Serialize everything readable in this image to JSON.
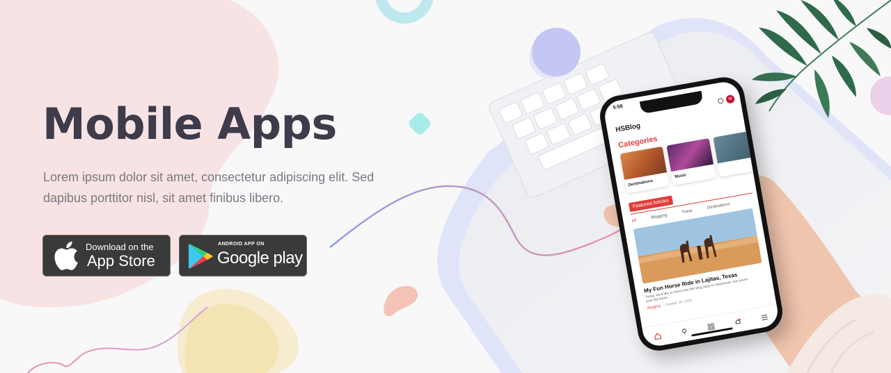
{
  "hero": {
    "title": "Mobile Apps",
    "description": "Lorem ipsum dolor sit amet, consectetur adipiscing elit. Sed dapibus porttitor nisl, sit amet finibus libero."
  },
  "store_buttons": {
    "apple": {
      "small": "Download on the",
      "large": "App Store"
    },
    "google": {
      "small": "ANDROID APP ON",
      "large": "Google play"
    }
  },
  "phone": {
    "status_time": "5:58",
    "avatar_letter": "M",
    "brand": "HSBlog",
    "categories_title": "Categories",
    "categories": [
      "Destinations",
      "Music"
    ],
    "featured_tab": "Featured Articles",
    "sub_tabs": [
      "All",
      "Blogging",
      "Trave",
      "Destinations"
    ],
    "article_title": "My Fun Horse Ride in Lajitas, Texas",
    "article_desc": "Today, we'd like to hand over the blog story to Savannah, our seven year old horse ...",
    "article_tag": "Blogging",
    "article_date": "October 15, 2019"
  },
  "colors": {
    "title": "#3e3b4b",
    "accent_red": "#e23b3b",
    "button_bg": "#3a3a3a"
  }
}
